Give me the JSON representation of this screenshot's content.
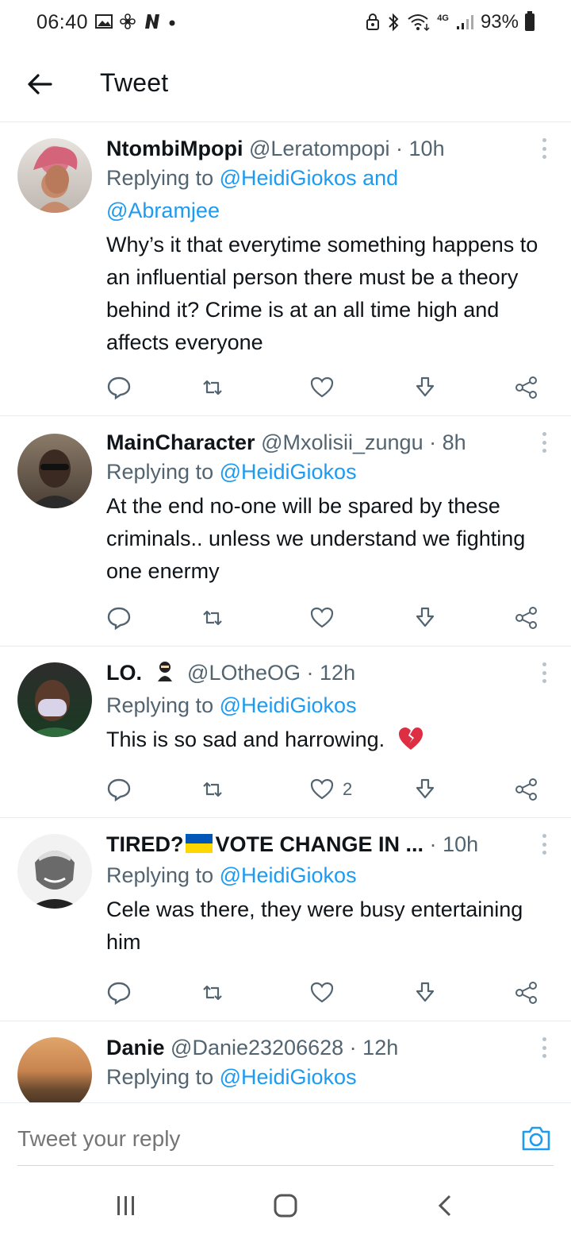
{
  "status_bar": {
    "time": "06:40",
    "battery": "93%",
    "network": "4G"
  },
  "header": {
    "title": "Tweet"
  },
  "tweets": [
    {
      "name": "NtombiMpopi",
      "handle": "@Lerato​mpopi",
      "time": "10h",
      "replying_prefix": "Replying to",
      "mentions": [
        "@HeidiGiokos",
        "and",
        "@Abramjee"
      ],
      "text": "Why’s it that everytime something happens to an influential person there must be a theory behind it? Crime is at an all time high and affects everyone",
      "like_count": ""
    },
    {
      "name": "MainCharacter",
      "handle": "@Mxolisii_zungu",
      "time": "8h",
      "replying_prefix": "Replying to",
      "mentions": [
        "@HeidiGiokos"
      ],
      "text": "At the end no-one will be spared by these criminals.. unless we understand we fighting one enermy",
      "like_count": ""
    },
    {
      "name": "LO.",
      "handle": "@LOtheOG",
      "time": "12h",
      "replying_prefix": "Replying to",
      "mentions": [
        "@HeidiGiokos"
      ],
      "text": "This is so sad and harrowing.",
      "like_count": "2"
    },
    {
      "name_part1": "TIRED?",
      "name_part2": "VOTE CHANGE IN ...",
      "handle": "",
      "time": "10h",
      "replying_prefix": "Replying to",
      "mentions": [
        "@HeidiGiokos"
      ],
      "text": "Cele was there, they were busy entertaining him",
      "like_count": ""
    },
    {
      "name": "Danie",
      "handle": "@Danie23206628",
      "time": "12h",
      "replying_prefix": "Replying to",
      "mentions": [
        "@HeidiGiokos"
      ],
      "text": ""
    }
  ],
  "reply_bar": {
    "placeholder": "Tweet your reply"
  },
  "colors": {
    "accent": "#1d9bf0",
    "text": "#0f1419",
    "secondary": "#536471",
    "border": "#e6ecf0"
  },
  "icons": {
    "reply": "comment-icon",
    "retweet": "retweet-icon",
    "like": "heart-icon",
    "download": "download-icon",
    "share": "share-icon"
  }
}
